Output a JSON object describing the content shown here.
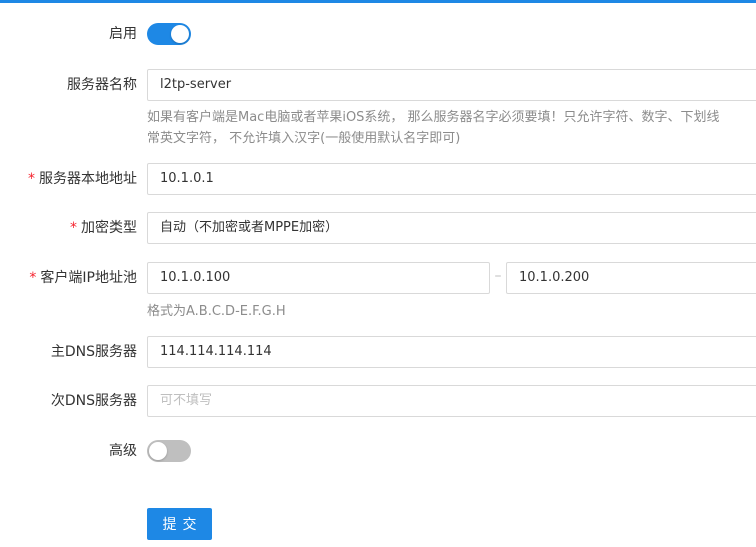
{
  "colors": {
    "accent": "#1e88e5",
    "required": "#f5222d",
    "help_text": "#8c8c8c",
    "placeholder": "#bfbfbf"
  },
  "form": {
    "enable": {
      "label": "启用",
      "state": "on"
    },
    "server_name": {
      "label": "服务器名称",
      "value": "l2tp-server",
      "help_line1": "如果有客户端是Mac电脑或者苹果iOS系统， 那么服务器名字必须要填！只允许字符、数字、下划线",
      "help_line2": "常英文字符， 不允许填入汉字(一般使用默认名字即可)"
    },
    "local_address": {
      "required_mark": "*",
      "label": "服务器本地地址",
      "value": "10.1.0.1"
    },
    "encryption": {
      "required_mark": "*",
      "label": "加密类型",
      "value": "自动（不加密或者MPPE加密）"
    },
    "client_pool": {
      "required_mark": "*",
      "label": "客户端IP地址池",
      "start": "10.1.0.100",
      "separator": "–",
      "end": "10.1.0.200",
      "help": "格式为A.B.C.D-E.F.G.H"
    },
    "primary_dns": {
      "label": "主DNS服务器",
      "value": "114.114.114.114"
    },
    "secondary_dns": {
      "label": "次DNS服务器",
      "placeholder": "可不填写"
    },
    "advanced": {
      "label": "高级",
      "state": "off"
    },
    "submit_label": "提交"
  }
}
